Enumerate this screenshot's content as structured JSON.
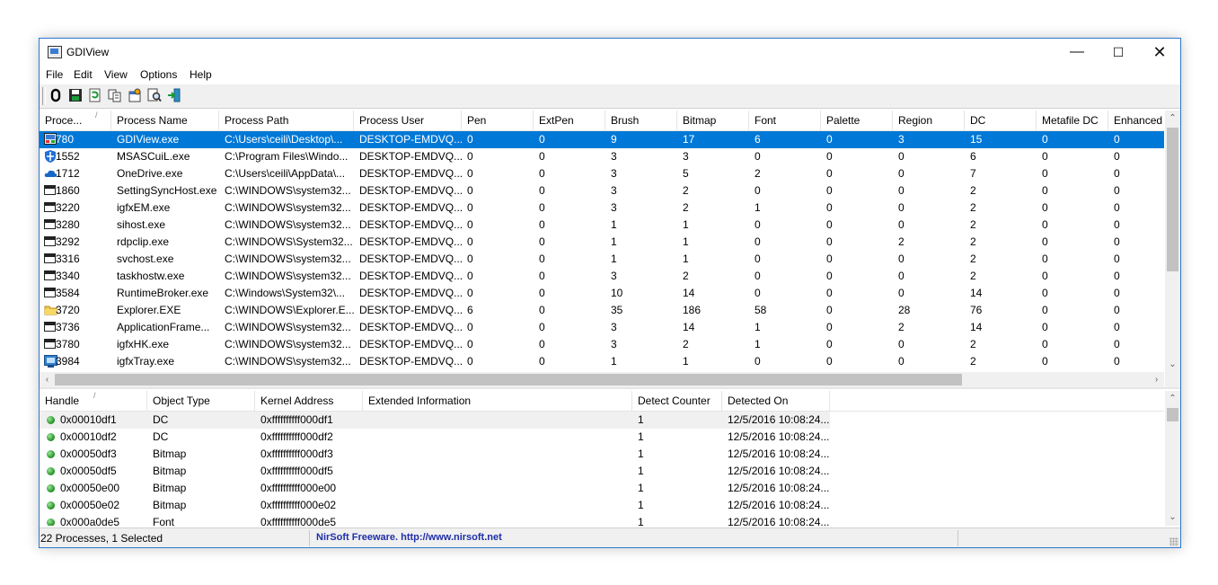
{
  "window": {
    "title": "GDIView",
    "min_icon": "minimize-icon",
    "max_icon": "maximize-icon",
    "close_icon": "close-icon"
  },
  "menu": [
    "File",
    "Edit",
    "View",
    "Options",
    "Help"
  ],
  "toolbar": {
    "icons": [
      "properties-icon",
      "save-icon",
      "refresh-icon",
      "copy-icon",
      "options-icon",
      "find-icon",
      "exit-icon"
    ]
  },
  "process_table": {
    "columns": [
      "Proce...",
      "Process Name",
      "Process Path",
      "Process User",
      "Pen",
      "ExtPen",
      "Brush",
      "Bitmap",
      "Font",
      "Palette",
      "Region",
      "DC",
      "Metafile DC",
      "Enhanced"
    ],
    "sort_indicator": "/",
    "rows": [
      {
        "icon": "gdiview-icon",
        "values": [
          "780",
          "GDIView.exe",
          "C:\\Users\\ceili\\Desktop\\...",
          "DESKTOP-EMDVQ...",
          "0",
          "0",
          "9",
          "17",
          "6",
          "0",
          "3",
          "15",
          "0",
          "0"
        ]
      },
      {
        "icon": "shield-icon",
        "values": [
          "1552",
          "MSASCuiL.exe",
          "C:\\Program Files\\Windo...",
          "DESKTOP-EMDVQ...",
          "0",
          "0",
          "3",
          "3",
          "0",
          "0",
          "0",
          "6",
          "0",
          "0"
        ]
      },
      {
        "icon": "cloud-icon",
        "values": [
          "1712",
          "OneDrive.exe",
          "C:\\Users\\ceili\\AppData\\...",
          "DESKTOP-EMDVQ...",
          "0",
          "0",
          "3",
          "5",
          "2",
          "0",
          "0",
          "7",
          "0",
          "0"
        ]
      },
      {
        "icon": "window-icon",
        "values": [
          "1860",
          "SettingSyncHost.exe",
          "C:\\WINDOWS\\system32...",
          "DESKTOP-EMDVQ...",
          "0",
          "0",
          "3",
          "2",
          "0",
          "0",
          "0",
          "2",
          "0",
          "0"
        ]
      },
      {
        "icon": "window-icon",
        "values": [
          "3220",
          "igfxEM.exe",
          "C:\\WINDOWS\\system32...",
          "DESKTOP-EMDVQ...",
          "0",
          "0",
          "3",
          "2",
          "1",
          "0",
          "0",
          "2",
          "0",
          "0"
        ]
      },
      {
        "icon": "window-icon",
        "values": [
          "3280",
          "sihost.exe",
          "C:\\WINDOWS\\system32...",
          "DESKTOP-EMDVQ...",
          "0",
          "0",
          "1",
          "1",
          "0",
          "0",
          "0",
          "2",
          "0",
          "0"
        ]
      },
      {
        "icon": "window-icon",
        "values": [
          "3292",
          "rdpclip.exe",
          "C:\\WINDOWS\\System32...",
          "DESKTOP-EMDVQ...",
          "0",
          "0",
          "1",
          "1",
          "0",
          "0",
          "2",
          "2",
          "0",
          "0"
        ]
      },
      {
        "icon": "window-icon",
        "values": [
          "3316",
          "svchost.exe",
          "C:\\WINDOWS\\system32...",
          "DESKTOP-EMDVQ...",
          "0",
          "0",
          "1",
          "1",
          "0",
          "0",
          "0",
          "2",
          "0",
          "0"
        ]
      },
      {
        "icon": "window-icon",
        "values": [
          "3340",
          "taskhostw.exe",
          "C:\\WINDOWS\\system32...",
          "DESKTOP-EMDVQ...",
          "0",
          "0",
          "3",
          "2",
          "0",
          "0",
          "0",
          "2",
          "0",
          "0"
        ]
      },
      {
        "icon": "window-icon",
        "values": [
          "3584",
          "RuntimeBroker.exe",
          "C:\\Windows\\System32\\...",
          "DESKTOP-EMDVQ...",
          "0",
          "0",
          "10",
          "14",
          "0",
          "0",
          "0",
          "14",
          "0",
          "0"
        ]
      },
      {
        "icon": "folder-icon",
        "values": [
          "3720",
          "Explorer.EXE",
          "C:\\WINDOWS\\Explorer.E...",
          "DESKTOP-EMDVQ...",
          "6",
          "0",
          "35",
          "186",
          "58",
          "0",
          "28",
          "76",
          "0",
          "0"
        ]
      },
      {
        "icon": "window-icon",
        "values": [
          "3736",
          "ApplicationFrame...",
          "C:\\WINDOWS\\system32...",
          "DESKTOP-EMDVQ...",
          "0",
          "0",
          "3",
          "14",
          "1",
          "0",
          "2",
          "14",
          "0",
          "0"
        ]
      },
      {
        "icon": "window-icon",
        "values": [
          "3780",
          "igfxHK.exe",
          "C:\\WINDOWS\\system32...",
          "DESKTOP-EMDVQ...",
          "0",
          "0",
          "3",
          "2",
          "1",
          "0",
          "0",
          "2",
          "0",
          "0"
        ]
      },
      {
        "icon": "tray-icon",
        "values": [
          "3984",
          "igfxTray.exe",
          "C:\\WINDOWS\\system32...",
          "DESKTOP-EMDVQ...",
          "0",
          "0",
          "1",
          "1",
          "0",
          "0",
          "0",
          "2",
          "0",
          "0"
        ]
      }
    ]
  },
  "handle_table": {
    "columns": [
      "Handle",
      "Object Type",
      "Kernel Address",
      "Extended Information",
      "Detect Counter",
      "Detected On"
    ],
    "sort_indicator": "/",
    "rows": [
      [
        "0x00010df1",
        "DC",
        "0xffffffffff000df1",
        "",
        "1",
        "12/5/2016 10:08:24..."
      ],
      [
        "0x00010df2",
        "DC",
        "0xffffffffff000df2",
        "",
        "1",
        "12/5/2016 10:08:24..."
      ],
      [
        "0x00050df3",
        "Bitmap",
        "0xffffffffff000df3",
        "",
        "1",
        "12/5/2016 10:08:24..."
      ],
      [
        "0x00050df5",
        "Bitmap",
        "0xffffffffff000df5",
        "",
        "1",
        "12/5/2016 10:08:24..."
      ],
      [
        "0x00050e00",
        "Bitmap",
        "0xffffffffff000e00",
        "",
        "1",
        "12/5/2016 10:08:24..."
      ],
      [
        "0x00050e02",
        "Bitmap",
        "0xffffffffff000e02",
        "",
        "1",
        "12/5/2016 10:08:24..."
      ],
      [
        "0x000a0de5",
        "Font",
        "0xffffffffff000de5",
        "",
        "1",
        "12/5/2016 10:08:24..."
      ]
    ]
  },
  "status": {
    "summary": "22 Processes, 1 Selected",
    "credit": "NirSoft Freeware.  http://www.nirsoft.net"
  }
}
